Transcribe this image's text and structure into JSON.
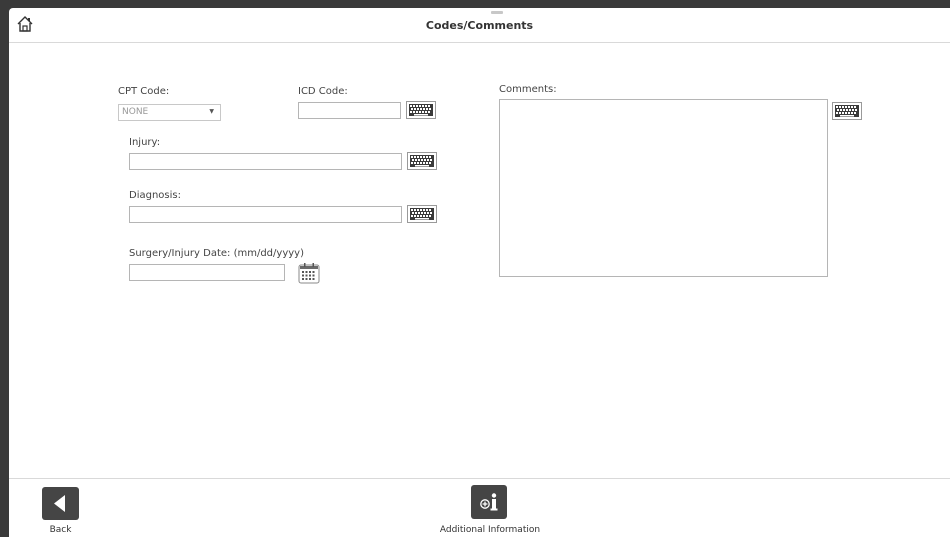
{
  "header": {
    "title": "Codes/Comments",
    "home_icon": "home-icon"
  },
  "form": {
    "cpt_code_label": "CPT Code:",
    "cpt_code_value": "NONE",
    "icd_code_label": "ICD Code:",
    "icd_code_value": "",
    "injury_label": "Injury:",
    "injury_value": "",
    "diagnosis_label": "Diagnosis:",
    "diagnosis_value": "",
    "surgery_date_label": "Surgery/Injury Date: (mm/dd/yyyy)",
    "surgery_date_value": "",
    "comments_label": "Comments:",
    "comments_value": ""
  },
  "footer": {
    "back_label": "Back",
    "additional_info_label": "Additional Information"
  },
  "colors": {
    "button_bg": "#454545",
    "background": "#ffffff",
    "border": "#b5b5b5"
  }
}
